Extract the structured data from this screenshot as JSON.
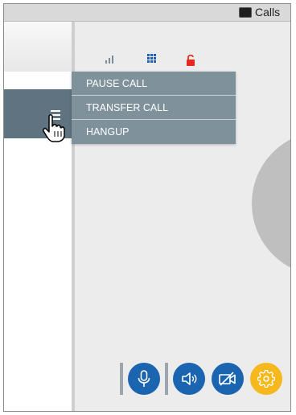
{
  "window": {
    "title": "Calls"
  },
  "icons": {
    "app": "terminal-app-icon",
    "menu": "hamburger-menu-icon",
    "cursor": "hand-pointer-icon",
    "signal": "signal-strength-icon",
    "keypad": "dialpad-icon",
    "lock": "unlocked-padlock-icon",
    "mic": "microphone-icon",
    "speaker": "speaker-icon",
    "video": "video-off-icon",
    "settings": "gear-icon"
  },
  "call_menu": {
    "items": [
      "PAUSE CALL",
      "TRANSFER CALL",
      "HANGUP"
    ]
  },
  "colors": {
    "menu_toggle": "#5f7480",
    "dropdown": "#7f929c",
    "control_blue": "#1a64b0",
    "settings_yellow": "#f6b81c",
    "lock_red": "#e52b1f",
    "keypad_blue": "#1f5fb8"
  }
}
